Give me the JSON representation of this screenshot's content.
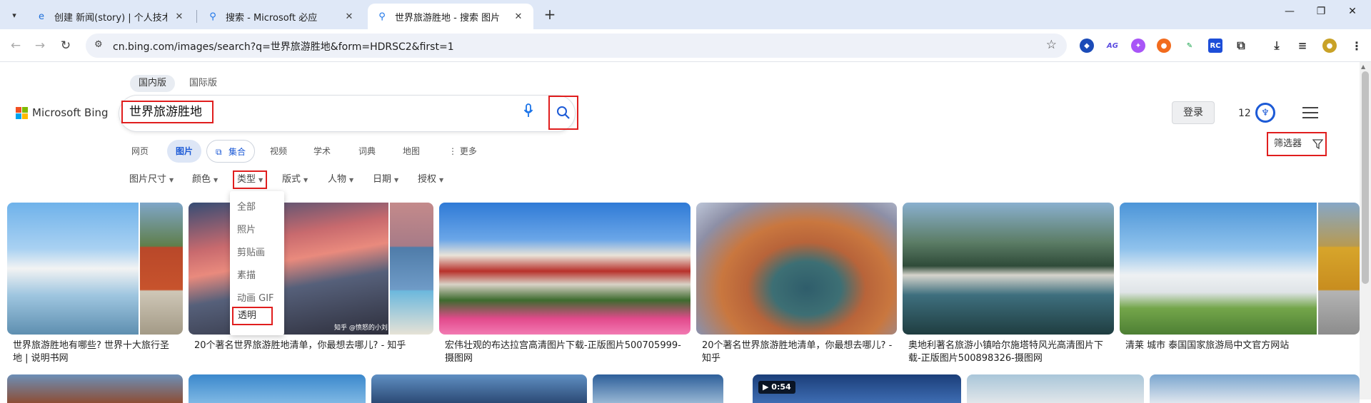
{
  "browser": {
    "tabs": [
      {
        "title": "创建 新闻(story) | 个人技术网_"
      },
      {
        "title": "搜索 - Microsoft 必应"
      },
      {
        "title": "世界旅游胜地 - 搜索 图片"
      }
    ],
    "url": "cn.bing.com/images/search?q=世界旅游胜地&form=HDRSC2&first=1",
    "extensions": [
      "AG",
      "RC"
    ]
  },
  "markets": [
    "国内版",
    "国际版"
  ],
  "logo_text": "Microsoft Bing",
  "search": {
    "query": "世界旅游胜地"
  },
  "header": {
    "signin": "登录",
    "rewards_count": "12"
  },
  "scope_tabs": [
    "网页",
    "图片",
    "集合",
    "视频",
    "学术",
    "词典",
    "地图",
    "更多"
  ],
  "filters": [
    "图片尺寸",
    "颜色",
    "类型",
    "版式",
    "人物",
    "日期",
    "授权"
  ],
  "filter_button": "筛选器",
  "type_dropdown": [
    "全部",
    "照片",
    "剪贴画",
    "素描",
    "动画 GIF",
    "透明"
  ],
  "results": [
    {
      "caption": "世界旅游胜地有哪些? 世界十大旅行圣地 | 说明书网"
    },
    {
      "caption": "20个著名世界旅游胜地清单，你最想去哪儿?  - 知乎",
      "watermark": "知乎 @愤怒的小刘"
    },
    {
      "caption": "宏伟壮观的布达拉宫高清图片下载-正版图片500705999-摄图网"
    },
    {
      "caption": "20个著名世界旅游胜地清单，你最想去哪儿? - 知乎"
    },
    {
      "caption": "奥地利著名旅游小镇哈尔施塔特风光高清图片下载-正版图片500898326-摄图网"
    },
    {
      "caption": "清莱 城市 泰国国家旅游局中文官方网站"
    }
  ],
  "video_duration": "0:54"
}
